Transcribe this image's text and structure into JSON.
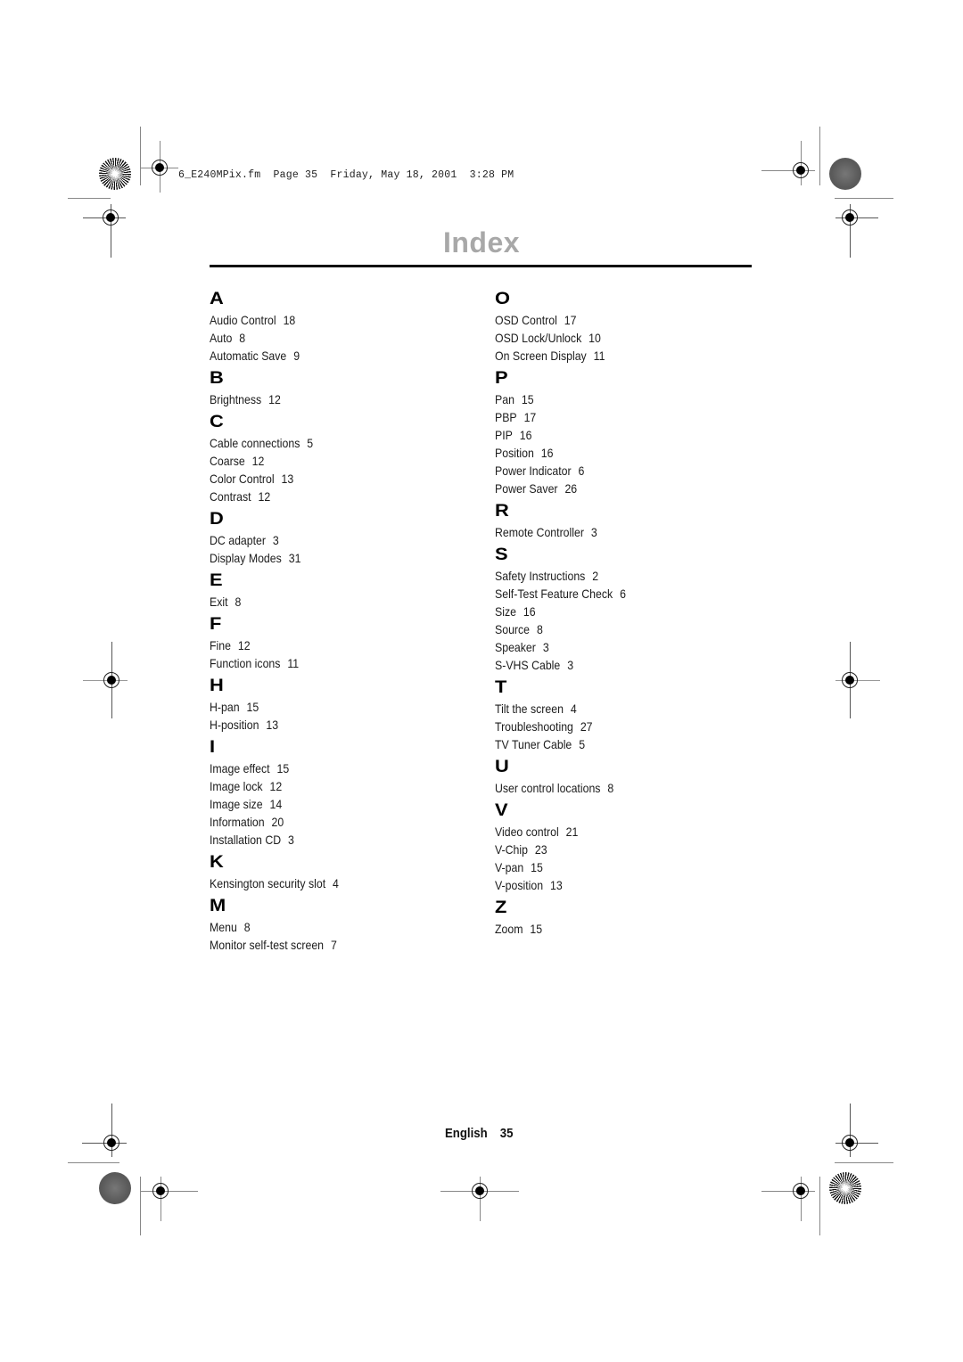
{
  "slug_line": "6_E240MPix.fm  Page 35  Friday, May 18, 2001  3:28 PM",
  "page_title": "Index",
  "columns": [
    {
      "sections": [
        {
          "letter": "A",
          "entries": [
            {
              "term": "Audio Control",
              "page": "18"
            },
            {
              "term": "Auto",
              "page": "8"
            },
            {
              "term": "Automatic Save",
              "page": "9"
            }
          ]
        },
        {
          "letter": "B",
          "entries": [
            {
              "term": "Brightness",
              "page": "12"
            }
          ]
        },
        {
          "letter": "C",
          "entries": [
            {
              "term": "Cable connections",
              "page": "5"
            },
            {
              "term": "Coarse",
              "page": "12"
            },
            {
              "term": "Color Control",
              "page": "13"
            },
            {
              "term": "Contrast",
              "page": "12"
            }
          ]
        },
        {
          "letter": "D",
          "entries": [
            {
              "term": "DC adapter",
              "page": "3"
            },
            {
              "term": "Display Modes",
              "page": "31"
            }
          ]
        },
        {
          "letter": "E",
          "entries": [
            {
              "term": "Exit",
              "page": "8"
            }
          ]
        },
        {
          "letter": "F",
          "entries": [
            {
              "term": "Fine",
              "page": "12"
            },
            {
              "term": "Function icons",
              "page": "11"
            }
          ]
        },
        {
          "letter": "H",
          "entries": [
            {
              "term": "H-pan",
              "page": "15"
            },
            {
              "term": "H-position",
              "page": "13"
            }
          ]
        },
        {
          "letter": "I",
          "entries": [
            {
              "term": "Image effect",
              "page": "15"
            },
            {
              "term": "Image lock",
              "page": "12"
            },
            {
              "term": "Image size",
              "page": "14"
            },
            {
              "term": "Information",
              "page": "20"
            },
            {
              "term": "Installation CD",
              "page": "3"
            }
          ]
        },
        {
          "letter": "K",
          "entries": [
            {
              "term": "Kensington security slot",
              "page": "4"
            }
          ]
        },
        {
          "letter": "M",
          "entries": [
            {
              "term": "Menu",
              "page": "8"
            },
            {
              "term": "Monitor self-test screen",
              "page": "7"
            }
          ]
        }
      ]
    },
    {
      "sections": [
        {
          "letter": "O",
          "entries": [
            {
              "term": "OSD Control",
              "page": "17"
            },
            {
              "term": "OSD Lock/Unlock",
              "page": "10"
            },
            {
              "term": "On Screen Display",
              "page": "11"
            }
          ]
        },
        {
          "letter": "P",
          "entries": [
            {
              "term": "Pan",
              "page": "15"
            },
            {
              "term": "PBP",
              "page": "17"
            },
            {
              "term": "PIP",
              "page": "16"
            },
            {
              "term": "Position",
              "page": "16"
            },
            {
              "term": "Power  Indicator",
              "page": "6"
            },
            {
              "term": "Power  Saver",
              "page": "26"
            }
          ]
        },
        {
          "letter": "R",
          "entries": [
            {
              "term": "Remote Controller",
              "page": "3"
            }
          ]
        },
        {
          "letter": "S",
          "entries": [
            {
              "term": "Safety Instructions",
              "page": "2"
            },
            {
              "term": "Self-Test Feature Check",
              "page": "6"
            },
            {
              "term": "Size",
              "page": "16"
            },
            {
              "term": "Source",
              "page": "8"
            },
            {
              "term": "Speaker",
              "page": "3"
            },
            {
              "term": "S-VHS Cable",
              "page": "3"
            }
          ]
        },
        {
          "letter": "T",
          "entries": [
            {
              "term": "Tilt the screen",
              "page": "4"
            },
            {
              "term": "Troubleshooting",
              "page": "27"
            },
            {
              "term": "TV Tuner Cable",
              "page": "5"
            }
          ]
        },
        {
          "letter": "U",
          "entries": [
            {
              "term": "User control locations",
              "page": "8"
            }
          ]
        },
        {
          "letter": "V",
          "entries": [
            {
              "term": "Video control",
              "page": "21"
            },
            {
              "term": "V-Chip",
              "page": "23"
            },
            {
              "term": "V-pan",
              "page": "15"
            },
            {
              "term": "V-position",
              "page": "13"
            }
          ]
        },
        {
          "letter": "Z",
          "entries": [
            {
              "term": "Zoom",
              "page": "15"
            }
          ]
        }
      ]
    }
  ],
  "footer": {
    "language": "English",
    "page_number": "35"
  },
  "icons": {
    "registration_mark": "crosshair-registration-icon",
    "star_target": "starburst-target-icon",
    "gray_disc": "gray-density-disc-icon"
  }
}
